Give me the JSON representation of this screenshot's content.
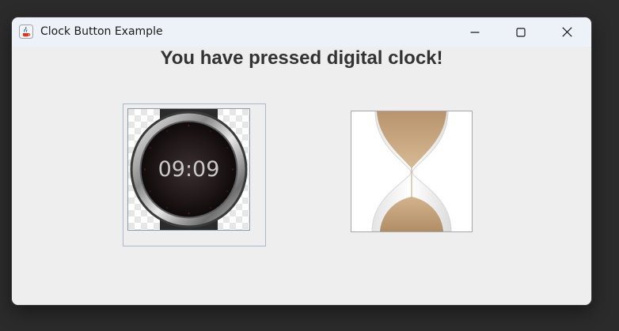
{
  "window": {
    "title": "Clock Button Example",
    "controls": {
      "minimize": "minimize",
      "maximize": "maximize",
      "close": "close"
    }
  },
  "main": {
    "heading": "You have pressed digital clock!",
    "buttons": [
      {
        "name": "digital-clock",
        "icon": "digital-watch-icon",
        "display_time": "09:09",
        "selected": true
      },
      {
        "name": "hourglass",
        "icon": "hourglass-icon",
        "selected": false
      }
    ]
  },
  "colors": {
    "window_bg": "#eeeeee",
    "titlebar_bg": "#edf2f8",
    "heading_text": "#333333",
    "focus_border": "#aab8cb",
    "sand": "#c9a882"
  }
}
